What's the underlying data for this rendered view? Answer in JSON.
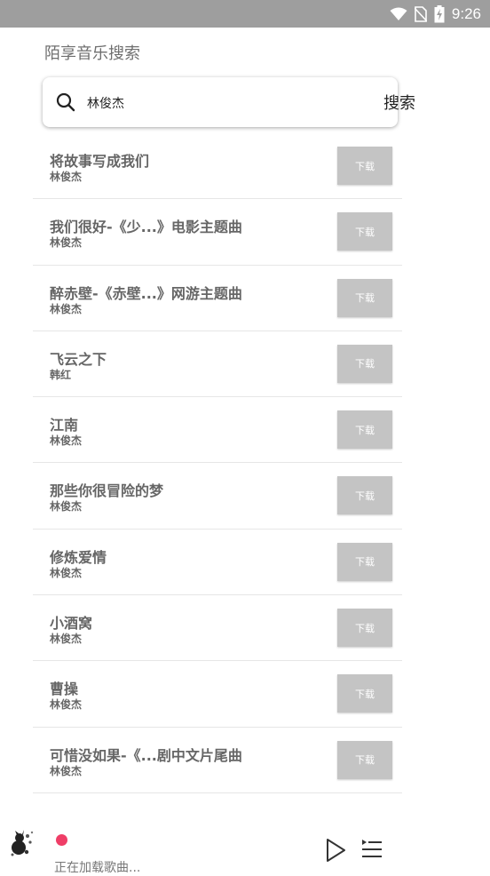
{
  "status_bar": {
    "time": "9:26",
    "icons": [
      "wifi-icon",
      "no-sim-icon",
      "battery-charging-icon"
    ]
  },
  "header": {
    "title": "陌享音乐搜索"
  },
  "search": {
    "value": "林俊杰",
    "button_label": "搜索",
    "icon": "search-icon"
  },
  "results": [
    {
      "title": "将故事写成我们",
      "artist": "林俊杰",
      "download_label": "下载"
    },
    {
      "title": "我们很好-《少...》电影主题曲",
      "artist": "林俊杰",
      "download_label": "下载"
    },
    {
      "title": "醉赤壁-《赤壁...》网游主题曲",
      "artist": "林俊杰",
      "download_label": "下载"
    },
    {
      "title": "飞云之下",
      "artist": "韩红",
      "download_label": "下载"
    },
    {
      "title": "江南",
      "artist": "林俊杰",
      "download_label": "下载"
    },
    {
      "title": "那些你很冒险的梦",
      "artist": "林俊杰",
      "download_label": "下载"
    },
    {
      "title": "修炼爱情",
      "artist": "林俊杰",
      "download_label": "下载"
    },
    {
      "title": "小酒窝",
      "artist": "林俊杰",
      "download_label": "下载"
    },
    {
      "title": "曹操",
      "artist": "林俊杰",
      "download_label": "下载"
    },
    {
      "title": "可惜没如果-《...剧中文片尾曲",
      "artist": "林俊杰",
      "download_label": "下载"
    }
  ],
  "player": {
    "status_text": "正在加载歌曲...",
    "accent_color": "#ef3e67",
    "icons": [
      "play-icon",
      "playlist-icon"
    ]
  }
}
